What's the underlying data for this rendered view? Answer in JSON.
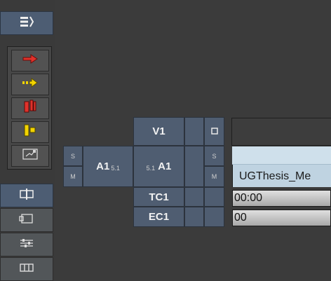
{
  "tracks": {
    "v1": "V1",
    "a1_source": "A1",
    "a1_source_format": "5.1",
    "a1_record_format": "5.1",
    "a1_record": "A1",
    "tc1": "TC1",
    "ec1": "EC1",
    "solo": "S",
    "mute": "M",
    "record_solo": "S",
    "record_mute": "M"
  },
  "timeline": {
    "clip_name": "UGThesis_Me",
    "tc1_value": "00:00",
    "ec1_value": "00"
  },
  "icons": {
    "menu": "hamburger-menu-icon",
    "red_arrow": "red-arrow-icon",
    "yellow_arrow": "yellow-dotted-arrow-icon",
    "red_segment": "red-segment-icon",
    "yellow_segment": "yellow-segment-icon",
    "link": "link-icon"
  },
  "colors": {
    "red": "#e0322b",
    "yellow": "#f3d400",
    "clip": "#bfd3e1",
    "track_blue": "#4f5d71"
  }
}
